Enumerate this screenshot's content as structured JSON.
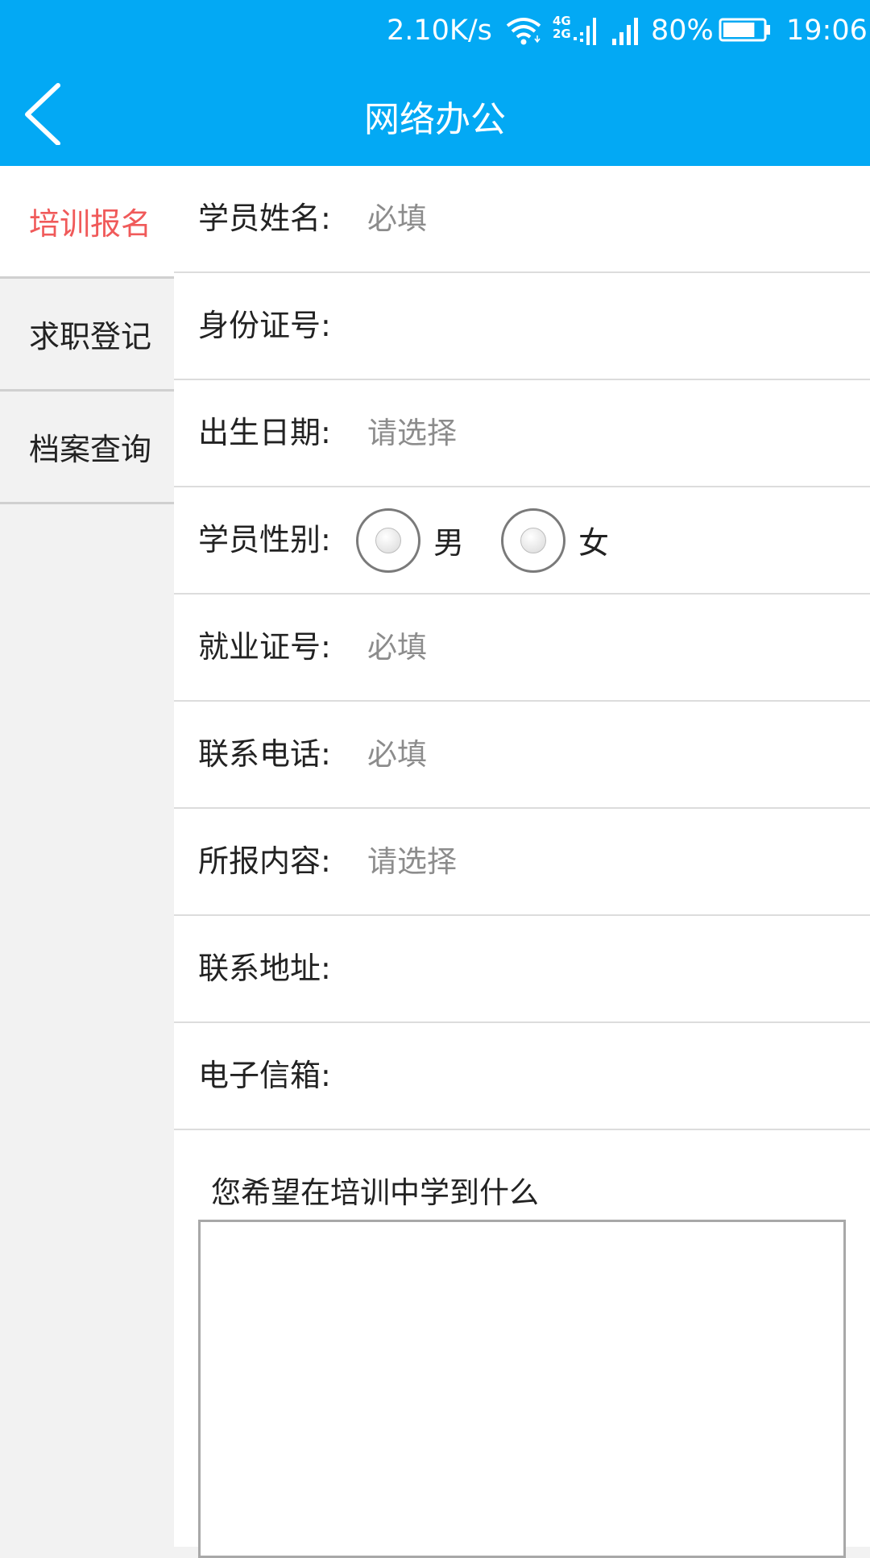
{
  "status_bar": {
    "net_speed": "2.10K/s",
    "network_types": [
      "4G",
      "2G"
    ],
    "battery_percent": "80%",
    "battery_level": 0.8,
    "time": "19:06",
    "icons": [
      "wifi-icon",
      "cell-signal-icon",
      "cell-signal-icon",
      "battery-icon"
    ]
  },
  "header": {
    "title": "网络办公",
    "back_icon": "chevron-left-icon",
    "color": "#03a9f4"
  },
  "sidebar": {
    "items": [
      {
        "label": "培训报名",
        "active": true
      },
      {
        "label": "求职登记",
        "active": false
      },
      {
        "label": "档案查询",
        "active": false
      }
    ],
    "active_color": "#f05a5a"
  },
  "form": {
    "name": {
      "label": "学员姓名:",
      "placeholder": "必填"
    },
    "id_number": {
      "label": "身份证号:",
      "placeholder": ""
    },
    "birth_date": {
      "label": "出生日期:",
      "placeholder": "请选择"
    },
    "gender": {
      "label": "学员性别:",
      "options": [
        "男",
        "女"
      ]
    },
    "employment_no": {
      "label": "就业证号:",
      "placeholder": "必填"
    },
    "phone": {
      "label": "联系电话:",
      "placeholder": "必填"
    },
    "content": {
      "label": "所报内容:",
      "placeholder": "请选择"
    },
    "address": {
      "label": "联系地址:",
      "placeholder": ""
    },
    "email": {
      "label": "电子信箱:",
      "placeholder": ""
    },
    "expectation_prompt": "您希望在培训中学到什么"
  }
}
